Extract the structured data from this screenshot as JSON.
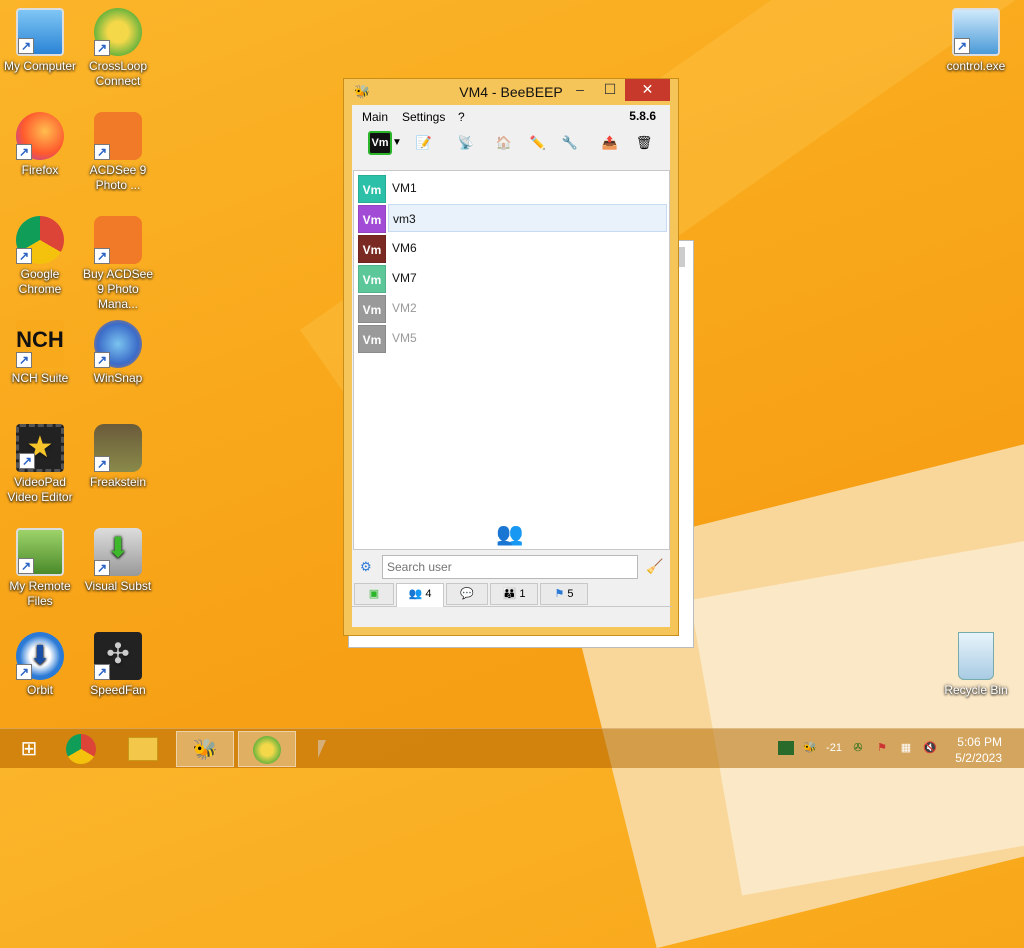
{
  "desktop": {
    "icons_left": [
      {
        "label": "My Computer",
        "icon": "computer-icon"
      },
      {
        "label": "CrossLoop Connect",
        "icon": "crossloop-icon"
      },
      {
        "label": "Firefox",
        "icon": "firefox-icon"
      },
      {
        "label": "ACDSee 9 Photo ...",
        "icon": "acdsee-icon"
      },
      {
        "label": "Google Chrome",
        "icon": "chrome-icon"
      },
      {
        "label": "Buy ACDSee 9 Photo Mana...",
        "icon": "acdsee-buy-icon"
      },
      {
        "label": "NCH Suite",
        "icon": "nch-icon"
      },
      {
        "label": "WinSnap",
        "icon": "winsnap-icon"
      },
      {
        "label": "VideoPad Video Editor",
        "icon": "videopad-icon"
      },
      {
        "label": "Freakstein",
        "icon": "freakstein-icon"
      },
      {
        "label": "My Remote Files",
        "icon": "remote-files-icon"
      },
      {
        "label": "Visual Subst",
        "icon": "visual-subst-icon"
      },
      {
        "label": "Orbit",
        "icon": "orbit-icon"
      },
      {
        "label": "SpeedFan",
        "icon": "speedfan-icon"
      }
    ],
    "control_exe": "control.exe",
    "recycle_bin": "Recycle Bin"
  },
  "window": {
    "title": "VM4 - BeeBEEP",
    "menu": {
      "main": "Main",
      "settings": "Settings",
      "help": "?"
    },
    "version": "5.8.6",
    "self_avatar": "Vm",
    "users": [
      {
        "avatar": "Vm",
        "name": "VM1",
        "color": "#2cc0a8",
        "online": true
      },
      {
        "avatar": "Vm",
        "name": "vm3",
        "color": "#a24bd6",
        "online": true
      },
      {
        "avatar": "Vm",
        "name": "VM6",
        "color": "#7a2a22",
        "online": true
      },
      {
        "avatar": "Vm",
        "name": "VM7",
        "color": "#5cc89a",
        "online": true
      },
      {
        "avatar": "Vm",
        "name": "VM2",
        "color": "#9a9a9a",
        "online": false
      },
      {
        "avatar": "Vm",
        "name": "VM5",
        "color": "#9a9a9a",
        "online": false
      }
    ],
    "search": {
      "placeholder": "Search user"
    },
    "tabs": [
      {
        "count": ""
      },
      {
        "count": "4"
      },
      {
        "count": ""
      },
      {
        "count": "1"
      },
      {
        "count": "5"
      }
    ]
  },
  "taskbar": {
    "tray_temp": "-21",
    "clock_time": "5:06 PM",
    "clock_date": "5/2/2023"
  },
  "colors": {
    "desktop_bg": "#f9a91c",
    "close_button": "#c7392a",
    "window_frame": "#f5c55a"
  }
}
